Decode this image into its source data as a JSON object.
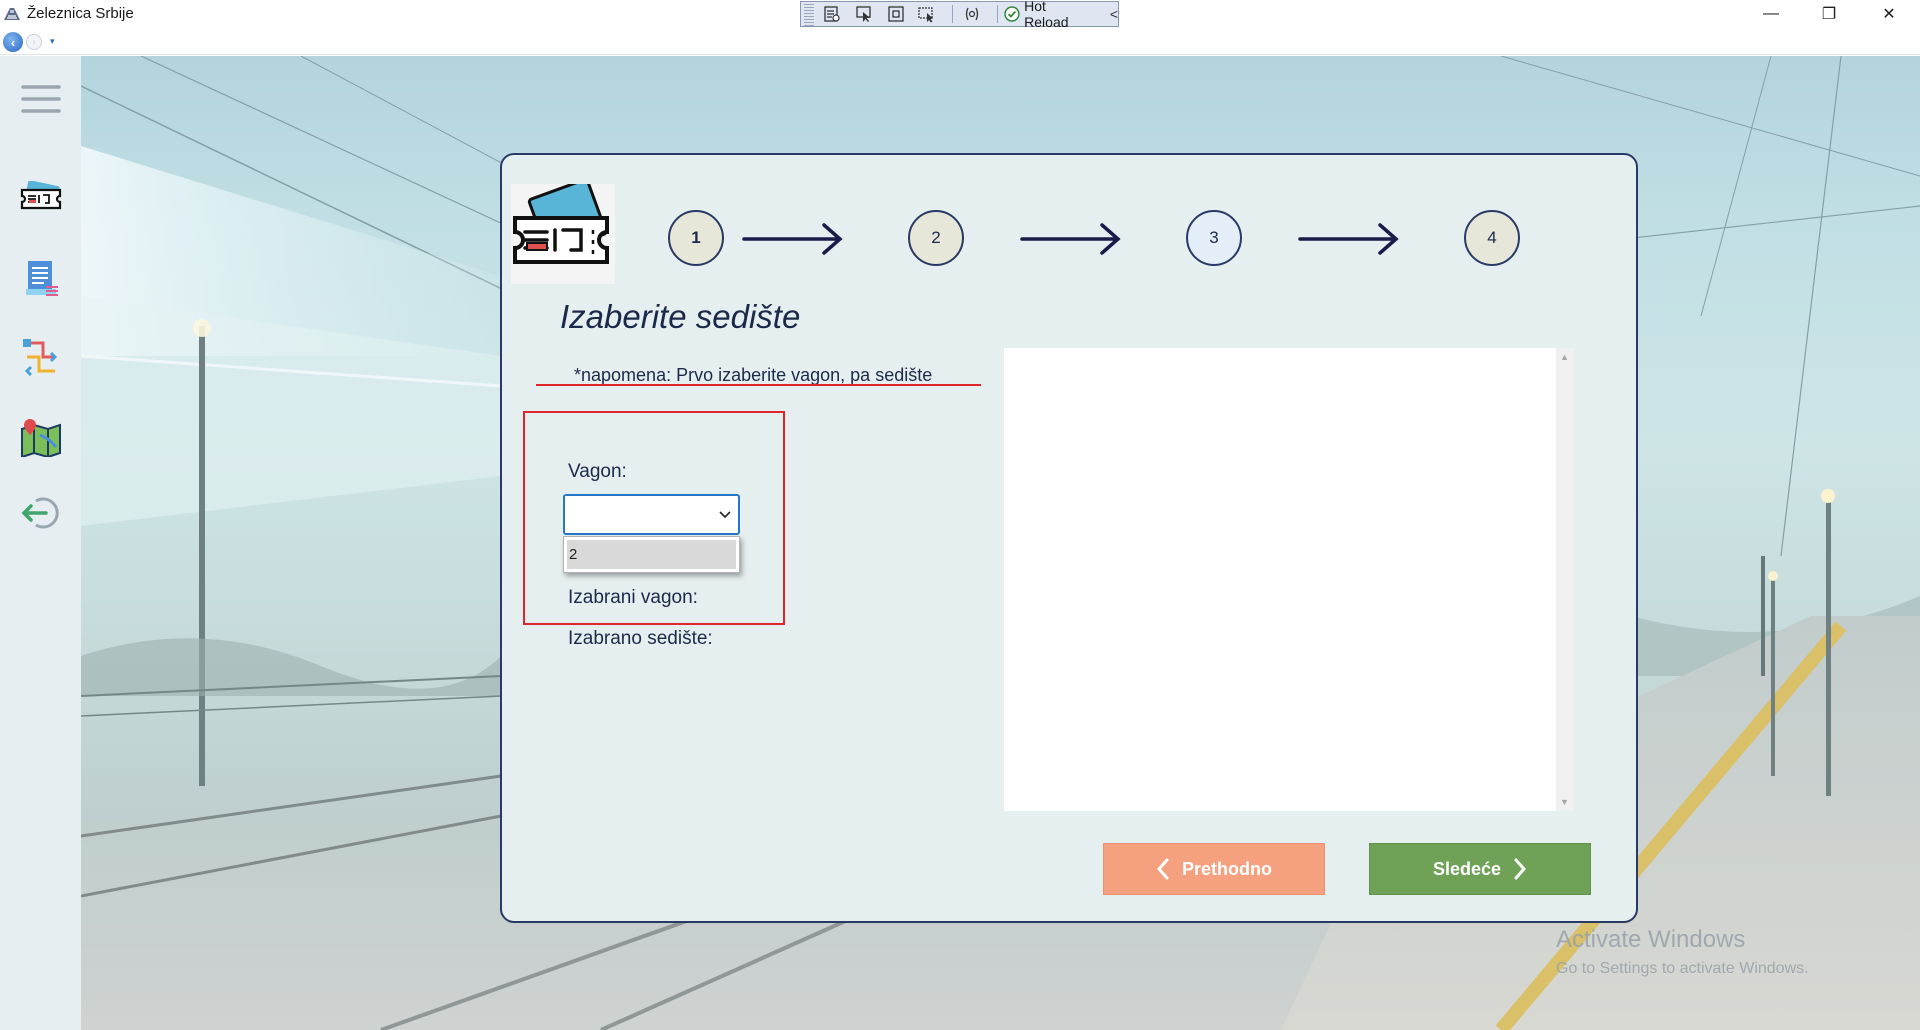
{
  "window": {
    "title": "Železnica Srbije",
    "controls": {
      "minimize": "—",
      "restore": "❐",
      "close": "✕"
    }
  },
  "hot_reload_toolbar": {
    "label": "Hot Reload",
    "tools": [
      "live-visual-tree-icon",
      "select-element-icon",
      "display-adorners-icon",
      "track-focus-icon",
      "binding-failures-icon"
    ]
  },
  "nav": {
    "back": "‹",
    "forward": "›",
    "dropdown": "▾"
  },
  "sidebar": {
    "items": [
      "menu-icon",
      "ticket-icon",
      "document-list-icon",
      "route-icon",
      "map-icon",
      "logout-icon"
    ]
  },
  "wizard": {
    "steps": [
      "1",
      "2",
      "3",
      "4"
    ],
    "current_step": 1
  },
  "page": {
    "heading": "Izaberite sedište",
    "note": "*napomena: Prvo izaberite vagon, pa sedište",
    "wagon_label": "Vagon:",
    "wagon_select_value": "",
    "wagon_options": [
      "2"
    ],
    "selected_wagon_label": "Izabrani vagon:",
    "selected_seat_label": "Izabrano sedište:"
  },
  "buttons": {
    "previous": "Prethodno",
    "next": "Sledeće"
  },
  "watermark": {
    "line1": "Activate Windows",
    "line2": "Go to Settings to activate Windows."
  },
  "colors": {
    "accent_navy": "#2a3a66",
    "prev_button": "#f5a07e",
    "next_button": "#6fa257",
    "highlight_red": "#e0242b",
    "select_border": "#2677c9"
  }
}
